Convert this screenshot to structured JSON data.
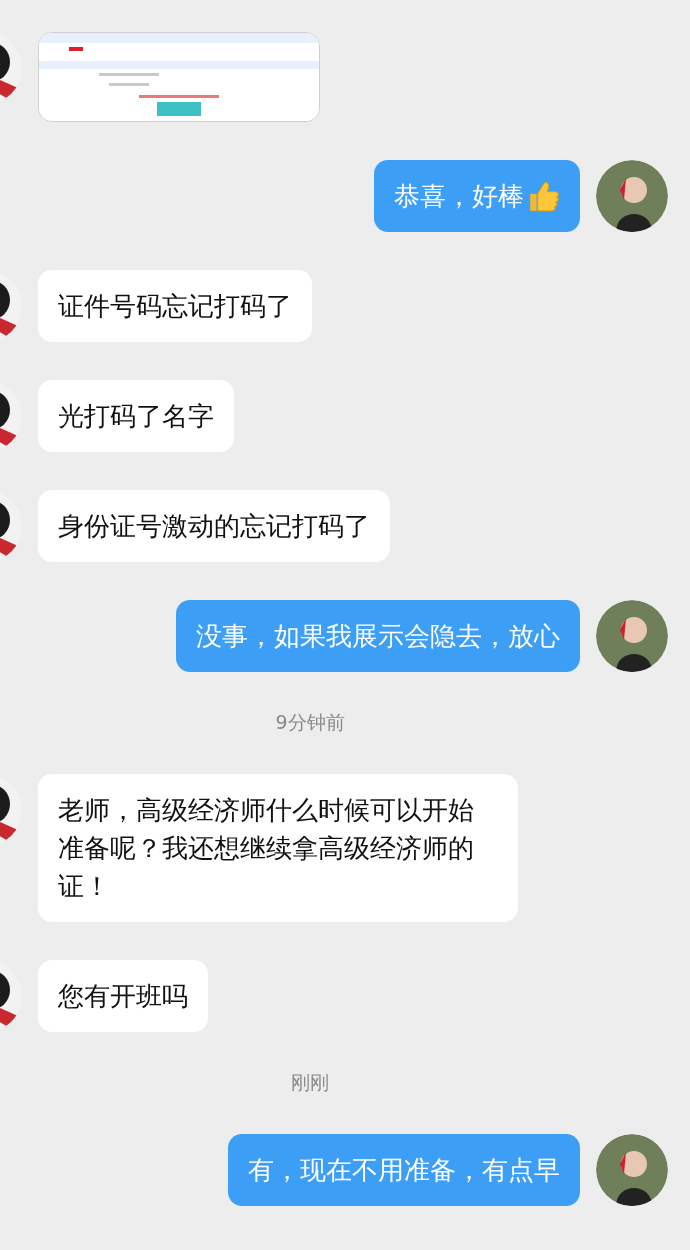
{
  "messages": [
    {
      "kind": "image",
      "outgoing": false
    },
    {
      "kind": "text",
      "outgoing": true,
      "text": "恭喜，好棒",
      "has_emoji": true
    },
    {
      "kind": "text",
      "outgoing": false,
      "text": "证件号码忘记打码了",
      "has_emoji": false
    },
    {
      "kind": "text",
      "outgoing": false,
      "text": "光打码了名字",
      "has_emoji": false
    },
    {
      "kind": "text",
      "outgoing": false,
      "text": "身份证号激动的忘记打码了",
      "has_emoji": false
    },
    {
      "kind": "text",
      "outgoing": true,
      "text": "没事，如果我展示会隐去，放心",
      "has_emoji": false
    },
    {
      "kind": "time",
      "text": "9分钟前"
    },
    {
      "kind": "text",
      "outgoing": false,
      "text": "老师，高级经济师什么时候可以开始准备呢？我还想继续拿高级经济师的证！",
      "has_emoji": false
    },
    {
      "kind": "text",
      "outgoing": false,
      "text": "您有开班吗",
      "has_emoji": false
    },
    {
      "kind": "time",
      "text": "刚刚"
    },
    {
      "kind": "text",
      "outgoing": true,
      "text": "有，现在不用准备，有点早",
      "has_emoji": false
    }
  ]
}
